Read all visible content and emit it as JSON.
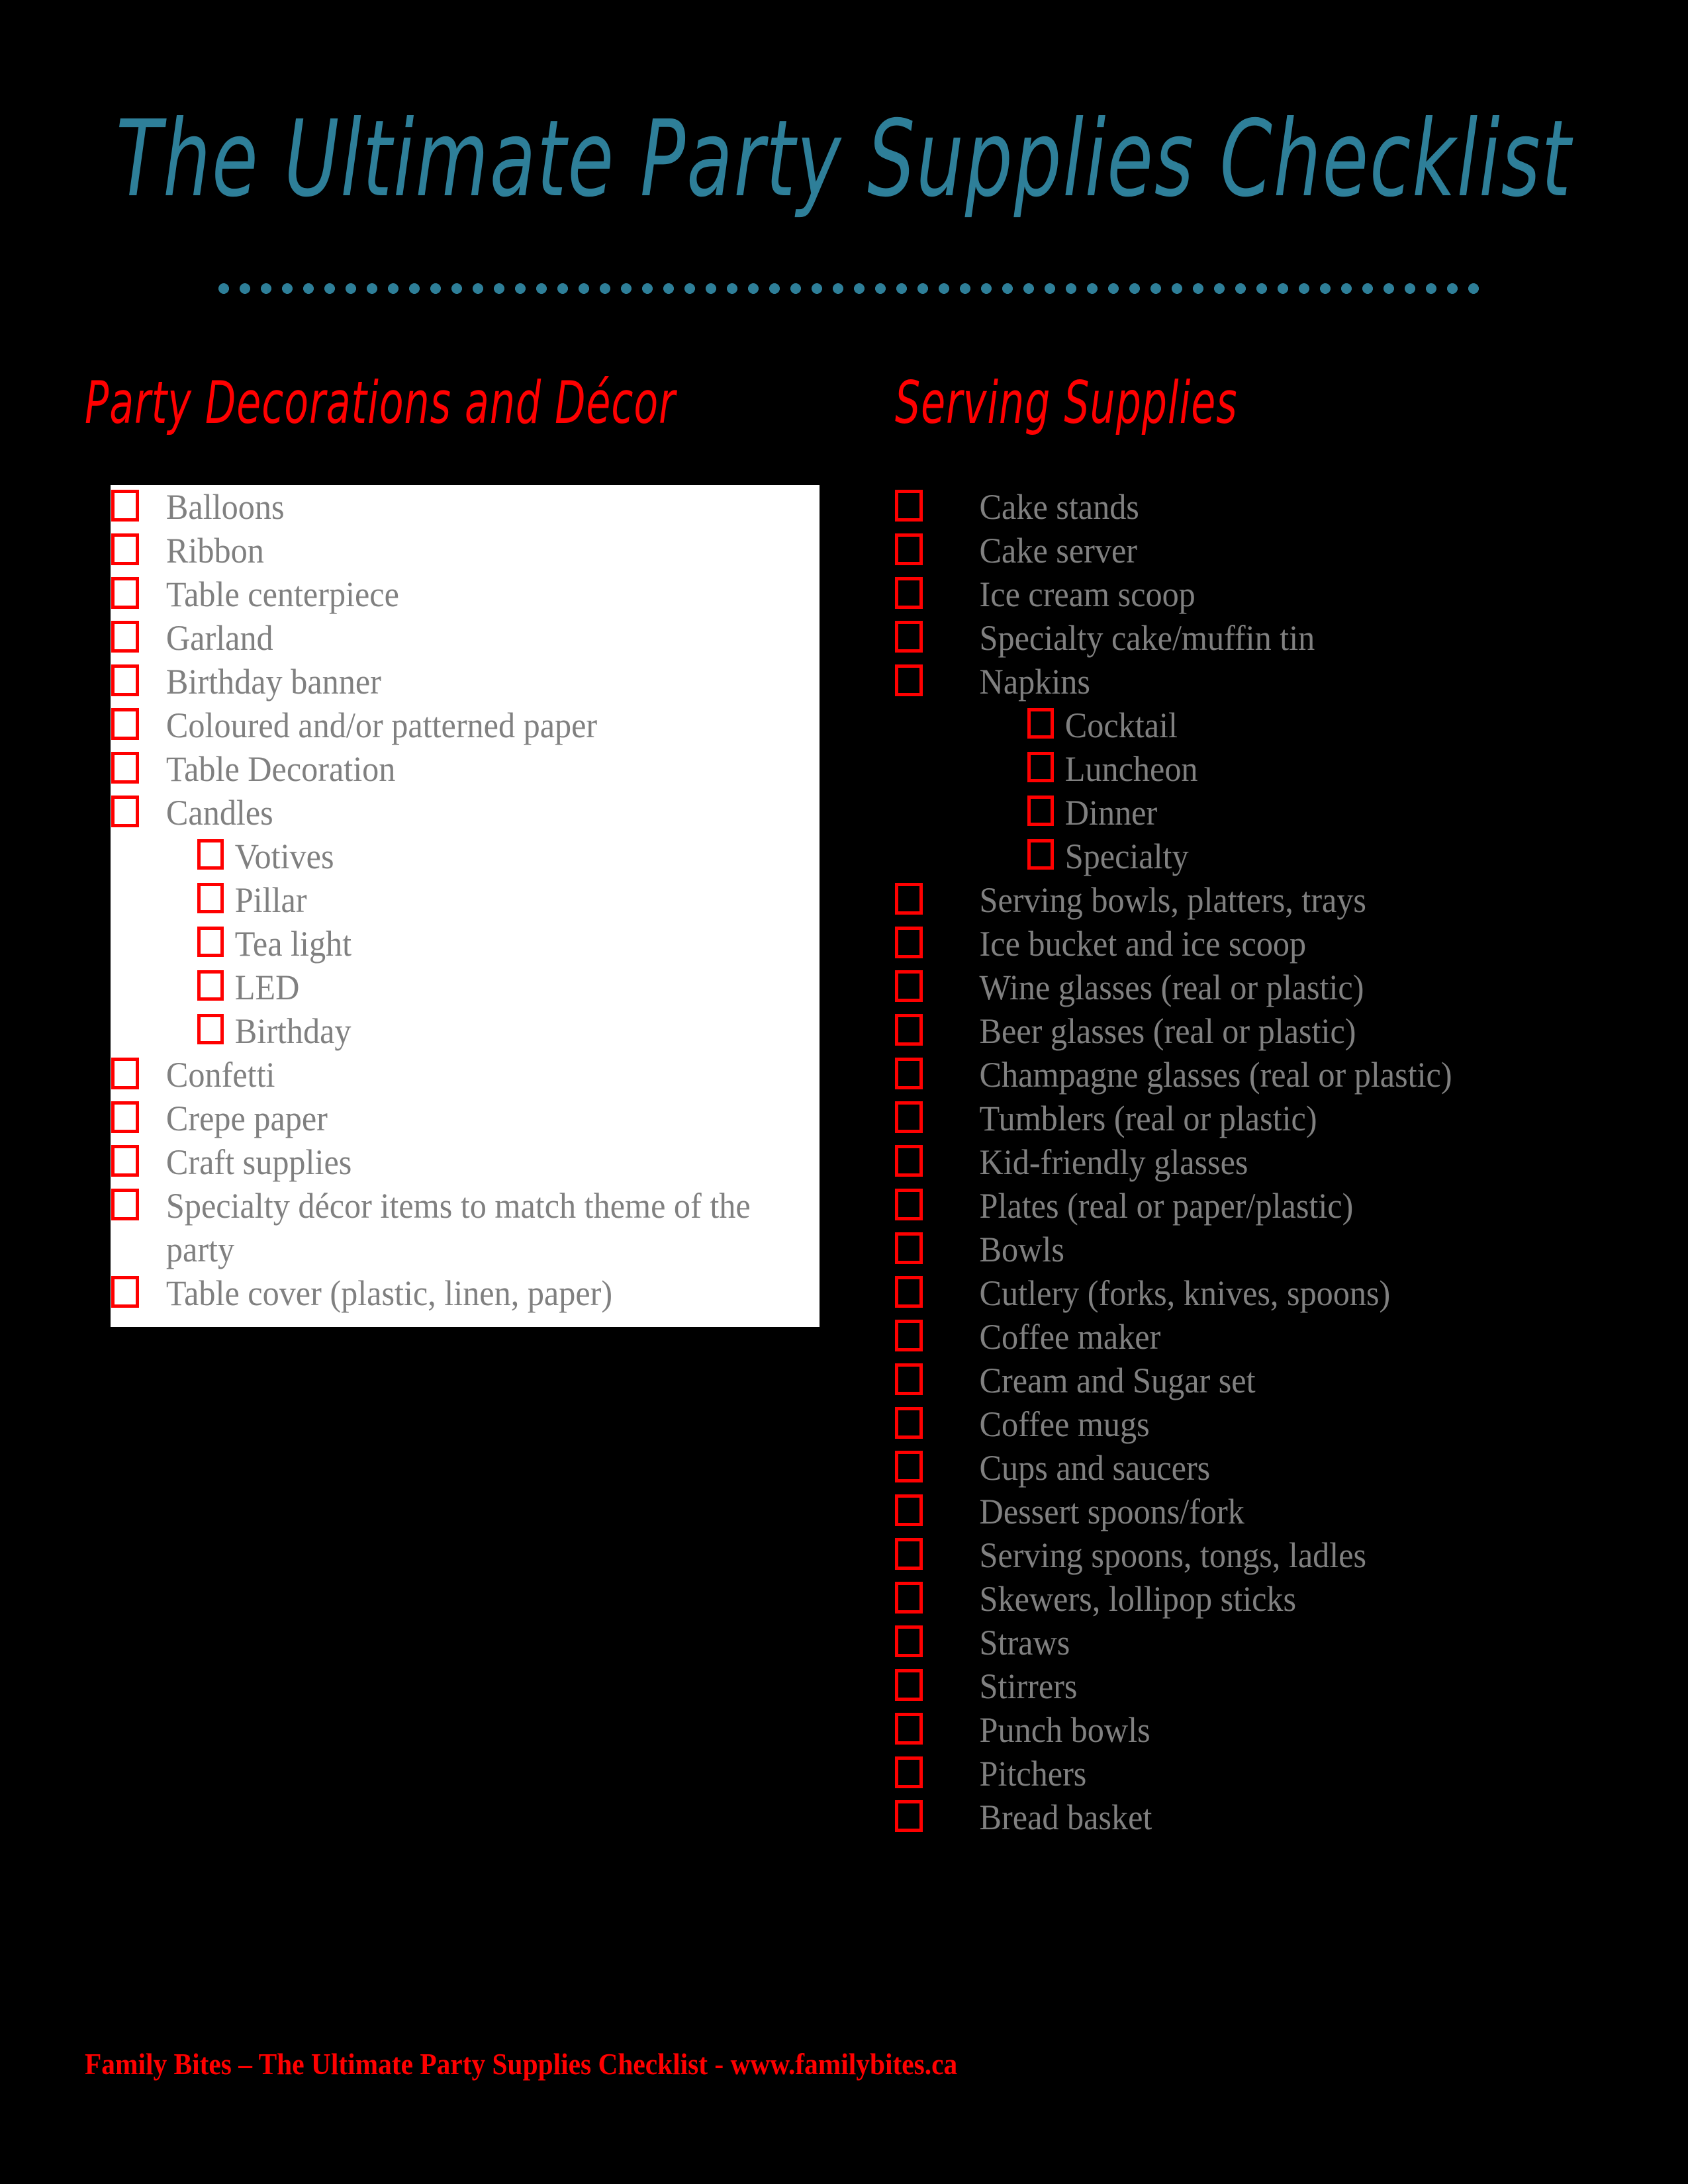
{
  "colors": {
    "background": "#000000",
    "title": "#2E7F99",
    "heading": "#FF0000",
    "item_text": "#808080",
    "checkbox": "#FF0000",
    "panel": "#FFFFFF",
    "footer": "#FF0000"
  },
  "title": "The Ultimate Party Supplies Checklist",
  "sections": [
    {
      "heading": "Party Decorations and Décor",
      "items": [
        {
          "label": "Balloons",
          "level": 0
        },
        {
          "label": "Ribbon",
          "level": 0
        },
        {
          "label": "Table centerpiece",
          "level": 0
        },
        {
          "label": "Garland",
          "level": 0
        },
        {
          "label": "Birthday banner",
          "level": 0
        },
        {
          "label": "Coloured and/or patterned paper",
          "level": 0
        },
        {
          "label": "Table Decoration",
          "level": 0
        },
        {
          "label": "Candles",
          "level": 0
        },
        {
          "label": "Votives",
          "level": 1
        },
        {
          "label": "Pillar",
          "level": 1
        },
        {
          "label": "Tea light",
          "level": 1
        },
        {
          "label": "LED",
          "level": 1
        },
        {
          "label": "Birthday",
          "level": 1
        },
        {
          "label": "Confetti",
          "level": 0
        },
        {
          "label": "Crepe paper",
          "level": 0
        },
        {
          "label": "Craft supplies",
          "level": 0
        },
        {
          "label": "Specialty décor items to match theme of the party",
          "level": 0
        },
        {
          "label": "Table cover (plastic, linen, paper)",
          "level": 0
        }
      ]
    },
    {
      "heading": "Serving Supplies",
      "items": [
        {
          "label": "Cake stands",
          "level": 0
        },
        {
          "label": "Cake server",
          "level": 0
        },
        {
          "label": "Ice cream scoop",
          "level": 0
        },
        {
          "label": "Specialty cake/muffin tin",
          "level": 0
        },
        {
          "label": "Napkins",
          "level": 0
        },
        {
          "label": "Cocktail",
          "level": 1
        },
        {
          "label": "Luncheon",
          "level": 1
        },
        {
          "label": "Dinner",
          "level": 1
        },
        {
          "label": "Specialty",
          "level": 1
        },
        {
          "label": "Serving bowls, platters, trays",
          "level": 0
        },
        {
          "label": "Ice bucket and ice scoop",
          "level": 0
        },
        {
          "label": "Wine glasses (real or plastic)",
          "level": 0
        },
        {
          "label": "Beer glasses (real or plastic)",
          "level": 0
        },
        {
          "label": "Champagne glasses (real or plastic)",
          "level": 0
        },
        {
          "label": "Tumblers (real or plastic)",
          "level": 0
        },
        {
          "label": "Kid-friendly glasses",
          "level": 0
        },
        {
          "label": "Plates (real or paper/plastic)",
          "level": 0
        },
        {
          "label": "Bowls",
          "level": 0
        },
        {
          "label": "Cutlery (forks, knives, spoons)",
          "level": 0
        },
        {
          "label": "Coffee maker",
          "level": 0
        },
        {
          "label": "Cream and Sugar set",
          "level": 0
        },
        {
          "label": "Coffee mugs",
          "level": 0
        },
        {
          "label": "Cups and saucers",
          "level": 0
        },
        {
          "label": "Dessert spoons/fork",
          "level": 0
        },
        {
          "label": "Serving spoons, tongs, ladles",
          "level": 0
        },
        {
          "label": "Skewers, lollipop sticks",
          "level": 0
        },
        {
          "label": "Straws",
          "level": 0
        },
        {
          "label": "Stirrers",
          "level": 0
        },
        {
          "label": "Punch bowls",
          "level": 0
        },
        {
          "label": "Pitchers",
          "level": 0
        },
        {
          "label": "Bread basket",
          "level": 0
        }
      ]
    }
  ],
  "footer": "Family Bites – The Ultimate Party Supplies Checklist - www.familybites.ca"
}
